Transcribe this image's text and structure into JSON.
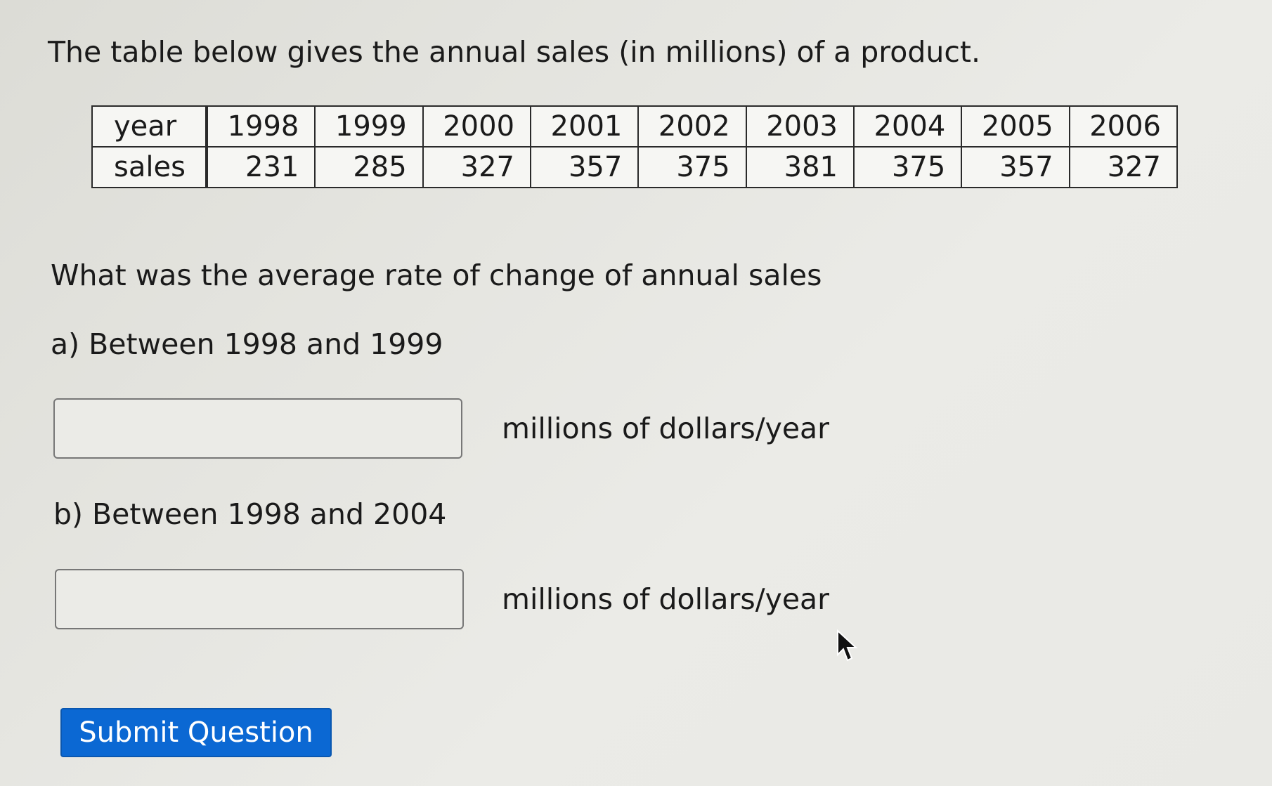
{
  "intro_text": "The table below gives the annual sales (in millions) of a product.",
  "table": {
    "row_headers": [
      "year",
      "sales"
    ],
    "years": [
      "1998",
      "1999",
      "2000",
      "2001",
      "2002",
      "2003",
      "2004",
      "2005",
      "2006"
    ],
    "sales": [
      "231",
      "285",
      "327",
      "357",
      "375",
      "381",
      "375",
      "357",
      "327"
    ]
  },
  "question_text": "What was the average rate of change of annual sales",
  "parts": [
    {
      "label": "a) Between 1998 and 1999",
      "value": "",
      "units": "millions of dollars/year"
    },
    {
      "label": "b) Between 1998 and 2004",
      "value": "",
      "units": "millions of dollars/year"
    }
  ],
  "submit_label": "Submit Question",
  "colors": {
    "submit_bg": "#0b68d3",
    "submit_text": "#ffffff",
    "background": "#e6e6e1"
  },
  "icons": {
    "cursor": "mouse-pointer-icon"
  }
}
